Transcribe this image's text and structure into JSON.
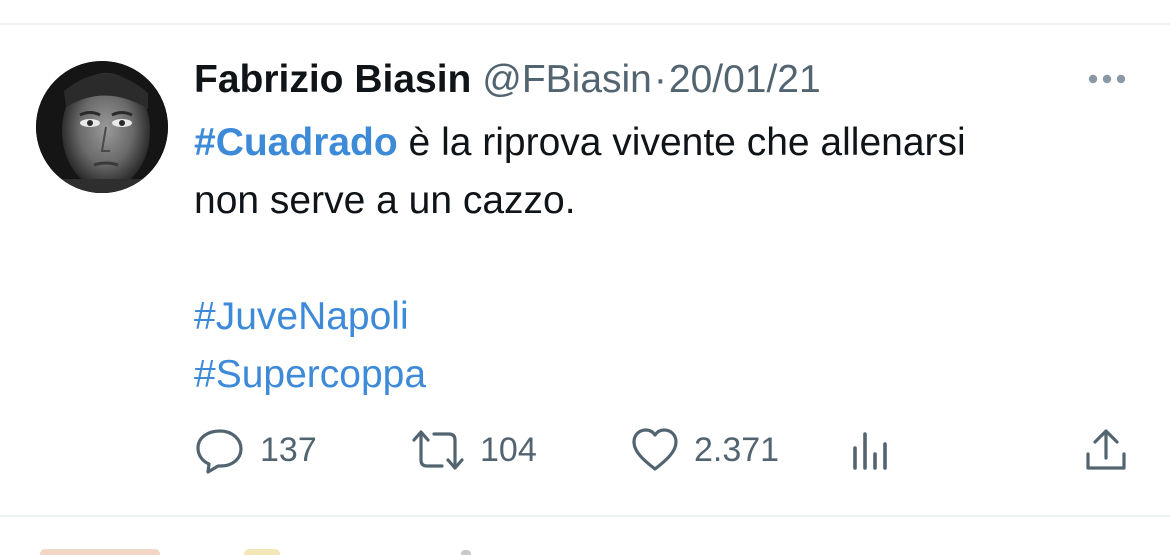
{
  "tweet": {
    "author_name": "Fabrizio Biasin",
    "handle": "@FBiasin",
    "separator": "·",
    "date": "20/01/21",
    "text": {
      "hashtag_cuadrado": "#Cuadrado",
      "line1_rest": " è la riprova vivente che allenarsi",
      "line2": "non serve a un cazzo.",
      "hashtag_juvenapoli": "#JuveNapoli",
      "hashtag_supercoppa": "#Supercoppa"
    }
  },
  "actions": {
    "reply_count": "137",
    "retweet_count": "104",
    "like_count": "2.371"
  },
  "icons": {
    "more": "more-horizontal-icon",
    "reply": "reply-icon",
    "retweet": "retweet-icon",
    "like": "heart-icon",
    "views": "analytics-icon",
    "share": "share-icon"
  },
  "colors": {
    "hashtag": "#3c8ad8",
    "text": "#0f1419",
    "secondary": "#536471"
  }
}
